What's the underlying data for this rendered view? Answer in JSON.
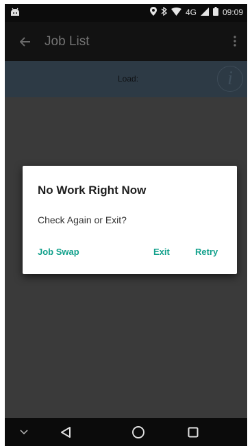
{
  "status_bar": {
    "time": "09:09",
    "network": "4G",
    "icons": [
      "android-icon",
      "location-icon",
      "bluetooth-icon",
      "wifi-icon",
      "signal-icon",
      "battery-icon"
    ]
  },
  "app_bar": {
    "title": "Job List",
    "back_icon": "arrow-left-icon",
    "menu_icon": "more-vert-icon"
  },
  "load_bar": {
    "label": "Load:",
    "info_glyph": "i"
  },
  "dialog": {
    "title": "No Work Right Now",
    "message": "Check Again or Exit?",
    "buttons": {
      "job_swap": "Job Swap",
      "exit": "Exit",
      "retry": "Retry"
    },
    "button_color": "#13a18c"
  },
  "nav_bar": {
    "icons": [
      "chevron-down-icon",
      "back-triangle-icon",
      "home-circle-icon",
      "recents-square-icon"
    ]
  }
}
